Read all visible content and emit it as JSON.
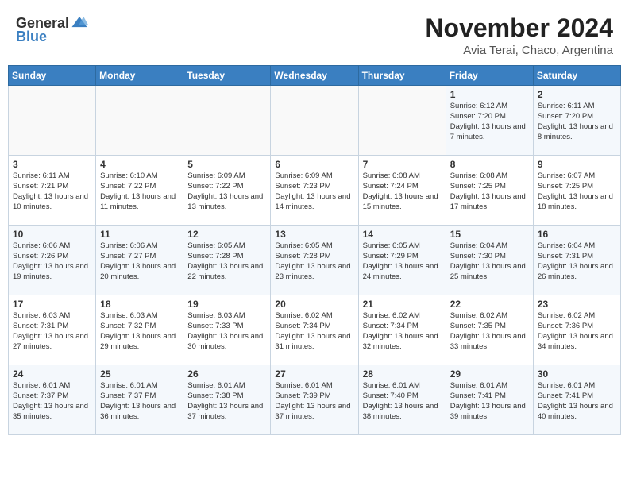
{
  "header": {
    "logo_general": "General",
    "logo_blue": "Blue",
    "month_year": "November 2024",
    "location": "Avia Terai, Chaco, Argentina"
  },
  "weekdays": [
    "Sunday",
    "Monday",
    "Tuesday",
    "Wednesday",
    "Thursday",
    "Friday",
    "Saturday"
  ],
  "weeks": [
    [
      {
        "day": "",
        "content": ""
      },
      {
        "day": "",
        "content": ""
      },
      {
        "day": "",
        "content": ""
      },
      {
        "day": "",
        "content": ""
      },
      {
        "day": "",
        "content": ""
      },
      {
        "day": "1",
        "content": "Sunrise: 6:12 AM\nSunset: 7:20 PM\nDaylight: 13 hours and 7 minutes."
      },
      {
        "day": "2",
        "content": "Sunrise: 6:11 AM\nSunset: 7:20 PM\nDaylight: 13 hours and 8 minutes."
      }
    ],
    [
      {
        "day": "3",
        "content": "Sunrise: 6:11 AM\nSunset: 7:21 PM\nDaylight: 13 hours and 10 minutes."
      },
      {
        "day": "4",
        "content": "Sunrise: 6:10 AM\nSunset: 7:22 PM\nDaylight: 13 hours and 11 minutes."
      },
      {
        "day": "5",
        "content": "Sunrise: 6:09 AM\nSunset: 7:22 PM\nDaylight: 13 hours and 13 minutes."
      },
      {
        "day": "6",
        "content": "Sunrise: 6:09 AM\nSunset: 7:23 PM\nDaylight: 13 hours and 14 minutes."
      },
      {
        "day": "7",
        "content": "Sunrise: 6:08 AM\nSunset: 7:24 PM\nDaylight: 13 hours and 15 minutes."
      },
      {
        "day": "8",
        "content": "Sunrise: 6:08 AM\nSunset: 7:25 PM\nDaylight: 13 hours and 17 minutes."
      },
      {
        "day": "9",
        "content": "Sunrise: 6:07 AM\nSunset: 7:25 PM\nDaylight: 13 hours and 18 minutes."
      }
    ],
    [
      {
        "day": "10",
        "content": "Sunrise: 6:06 AM\nSunset: 7:26 PM\nDaylight: 13 hours and 19 minutes."
      },
      {
        "day": "11",
        "content": "Sunrise: 6:06 AM\nSunset: 7:27 PM\nDaylight: 13 hours and 20 minutes."
      },
      {
        "day": "12",
        "content": "Sunrise: 6:05 AM\nSunset: 7:28 PM\nDaylight: 13 hours and 22 minutes."
      },
      {
        "day": "13",
        "content": "Sunrise: 6:05 AM\nSunset: 7:28 PM\nDaylight: 13 hours and 23 minutes."
      },
      {
        "day": "14",
        "content": "Sunrise: 6:05 AM\nSunset: 7:29 PM\nDaylight: 13 hours and 24 minutes."
      },
      {
        "day": "15",
        "content": "Sunrise: 6:04 AM\nSunset: 7:30 PM\nDaylight: 13 hours and 25 minutes."
      },
      {
        "day": "16",
        "content": "Sunrise: 6:04 AM\nSunset: 7:31 PM\nDaylight: 13 hours and 26 minutes."
      }
    ],
    [
      {
        "day": "17",
        "content": "Sunrise: 6:03 AM\nSunset: 7:31 PM\nDaylight: 13 hours and 27 minutes."
      },
      {
        "day": "18",
        "content": "Sunrise: 6:03 AM\nSunset: 7:32 PM\nDaylight: 13 hours and 29 minutes."
      },
      {
        "day": "19",
        "content": "Sunrise: 6:03 AM\nSunset: 7:33 PM\nDaylight: 13 hours and 30 minutes."
      },
      {
        "day": "20",
        "content": "Sunrise: 6:02 AM\nSunset: 7:34 PM\nDaylight: 13 hours and 31 minutes."
      },
      {
        "day": "21",
        "content": "Sunrise: 6:02 AM\nSunset: 7:34 PM\nDaylight: 13 hours and 32 minutes."
      },
      {
        "day": "22",
        "content": "Sunrise: 6:02 AM\nSunset: 7:35 PM\nDaylight: 13 hours and 33 minutes."
      },
      {
        "day": "23",
        "content": "Sunrise: 6:02 AM\nSunset: 7:36 PM\nDaylight: 13 hours and 34 minutes."
      }
    ],
    [
      {
        "day": "24",
        "content": "Sunrise: 6:01 AM\nSunset: 7:37 PM\nDaylight: 13 hours and 35 minutes."
      },
      {
        "day": "25",
        "content": "Sunrise: 6:01 AM\nSunset: 7:37 PM\nDaylight: 13 hours and 36 minutes."
      },
      {
        "day": "26",
        "content": "Sunrise: 6:01 AM\nSunset: 7:38 PM\nDaylight: 13 hours and 37 minutes."
      },
      {
        "day": "27",
        "content": "Sunrise: 6:01 AM\nSunset: 7:39 PM\nDaylight: 13 hours and 37 minutes."
      },
      {
        "day": "28",
        "content": "Sunrise: 6:01 AM\nSunset: 7:40 PM\nDaylight: 13 hours and 38 minutes."
      },
      {
        "day": "29",
        "content": "Sunrise: 6:01 AM\nSunset: 7:41 PM\nDaylight: 13 hours and 39 minutes."
      },
      {
        "day": "30",
        "content": "Sunrise: 6:01 AM\nSunset: 7:41 PM\nDaylight: 13 hours and 40 minutes."
      }
    ]
  ]
}
